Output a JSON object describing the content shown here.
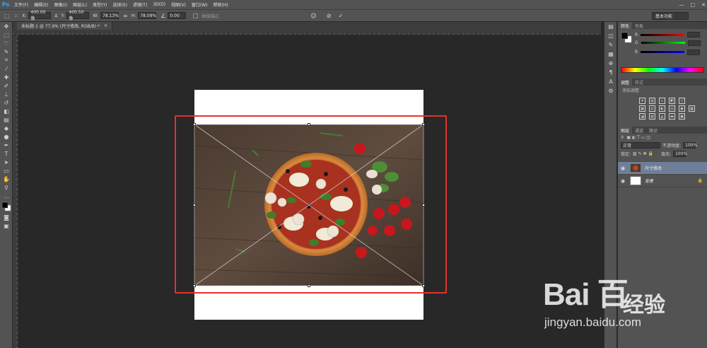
{
  "app": {
    "logo": "Ps"
  },
  "menu": [
    "文件(F)",
    "编辑(E)",
    "图像(I)",
    "图层(L)",
    "类型(Y)",
    "选择(S)",
    "滤镜(T)",
    "3D(D)",
    "视图(V)",
    "窗口(W)",
    "帮助(H)"
  ],
  "window_controls": [
    "—",
    "□",
    "✕"
  ],
  "options": {
    "x_label": "X:",
    "x_value": "400.00 像",
    "y_label": "Y:",
    "y_value": "400.50 像",
    "w_label": "W:",
    "w_value": "78.13%",
    "h_label": "H:",
    "h_value": "78.09%",
    "angle_value": "0.00",
    "interp_label": "插值描边",
    "cancel_icon": "⊘",
    "commit_icon": "✓",
    "workspace": "基本功能"
  },
  "document_tab": {
    "title": "未标题-1 @ 77.9% (尺寸修改, RGB/8) *",
    "close": "×"
  },
  "panels": {
    "color_tabs": [
      "颜色",
      "色板"
    ],
    "color_channels": [
      "R",
      "G",
      "B"
    ],
    "adjust_tabs": [
      "调整",
      "样式"
    ],
    "adjust_hint": "添加调整",
    "layers_tabs": [
      "图层",
      "通道",
      "路径"
    ],
    "blend_mode": "正常",
    "opacity_label": "不透明度:",
    "opacity_value": "100%",
    "lock_label": "锁定:",
    "fill_label": "填充:",
    "fill_value": "100%",
    "layers": [
      {
        "name": "尺寸修改",
        "selected": true
      },
      {
        "name": "背景",
        "selected": false
      }
    ]
  },
  "watermark": {
    "logo": "Bai 百",
    "brand_cn": "经验",
    "url": "jingyan.baidu.com"
  },
  "colors": {
    "highlight": "#e8312a",
    "accent": "#3fa0e8",
    "selected_layer": "#6f7f99"
  }
}
